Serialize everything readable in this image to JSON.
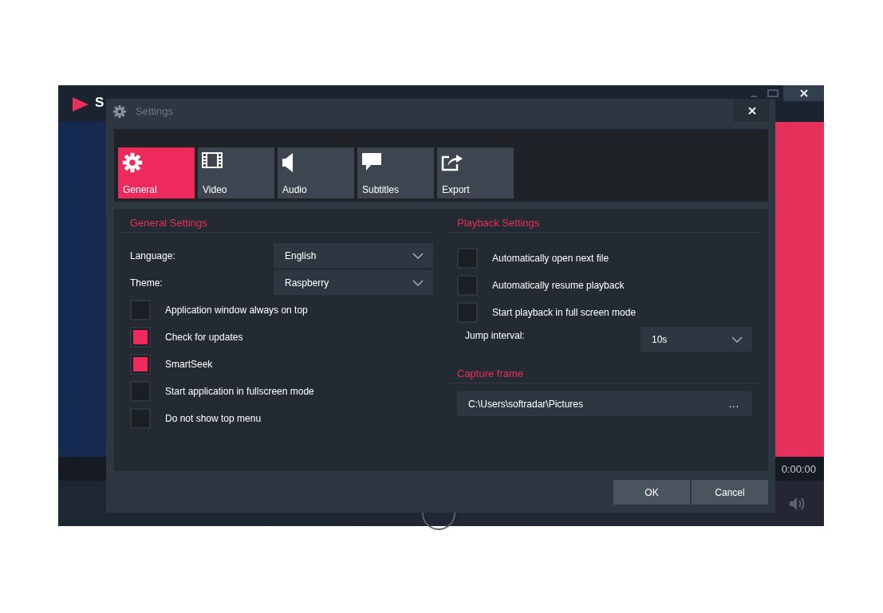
{
  "app": {
    "title": "S",
    "time": "0:00:00"
  },
  "dialog": {
    "title": "Settings",
    "tabs": [
      {
        "label": "General",
        "selected": true
      },
      {
        "label": "Video",
        "selected": false
      },
      {
        "label": "Audio",
        "selected": false
      },
      {
        "label": "Subtitles",
        "selected": false
      },
      {
        "label": "Export",
        "selected": false
      }
    ],
    "general": {
      "heading": "General Settings",
      "selects": [
        {
          "label": "Language:",
          "value": "English"
        },
        {
          "label": "Theme:",
          "value": "Raspberry"
        }
      ],
      "options": [
        {
          "label": "Application window always on top",
          "checked": false
        },
        {
          "label": "Check for updates",
          "checked": true
        },
        {
          "label": "SmartSeek",
          "checked": true
        },
        {
          "label": "Start application in fullscreen mode",
          "checked": false
        },
        {
          "label": "Do not show top menu",
          "checked": false
        }
      ]
    },
    "playback": {
      "heading": "Playback Settings",
      "options": [
        {
          "label": "Automatically open next file",
          "checked": false
        },
        {
          "label": "Automatically resume playback",
          "checked": false
        },
        {
          "label": "Start playback in full screen mode",
          "checked": false
        }
      ],
      "jump": {
        "label": "Jump interval:",
        "value": "10s"
      }
    },
    "capture": {
      "heading": "Capture frame",
      "path": "C:\\Users\\softradar\\Pictures",
      "browse": "..."
    },
    "buttons": [
      "OK",
      "Cancel"
    ]
  }
}
